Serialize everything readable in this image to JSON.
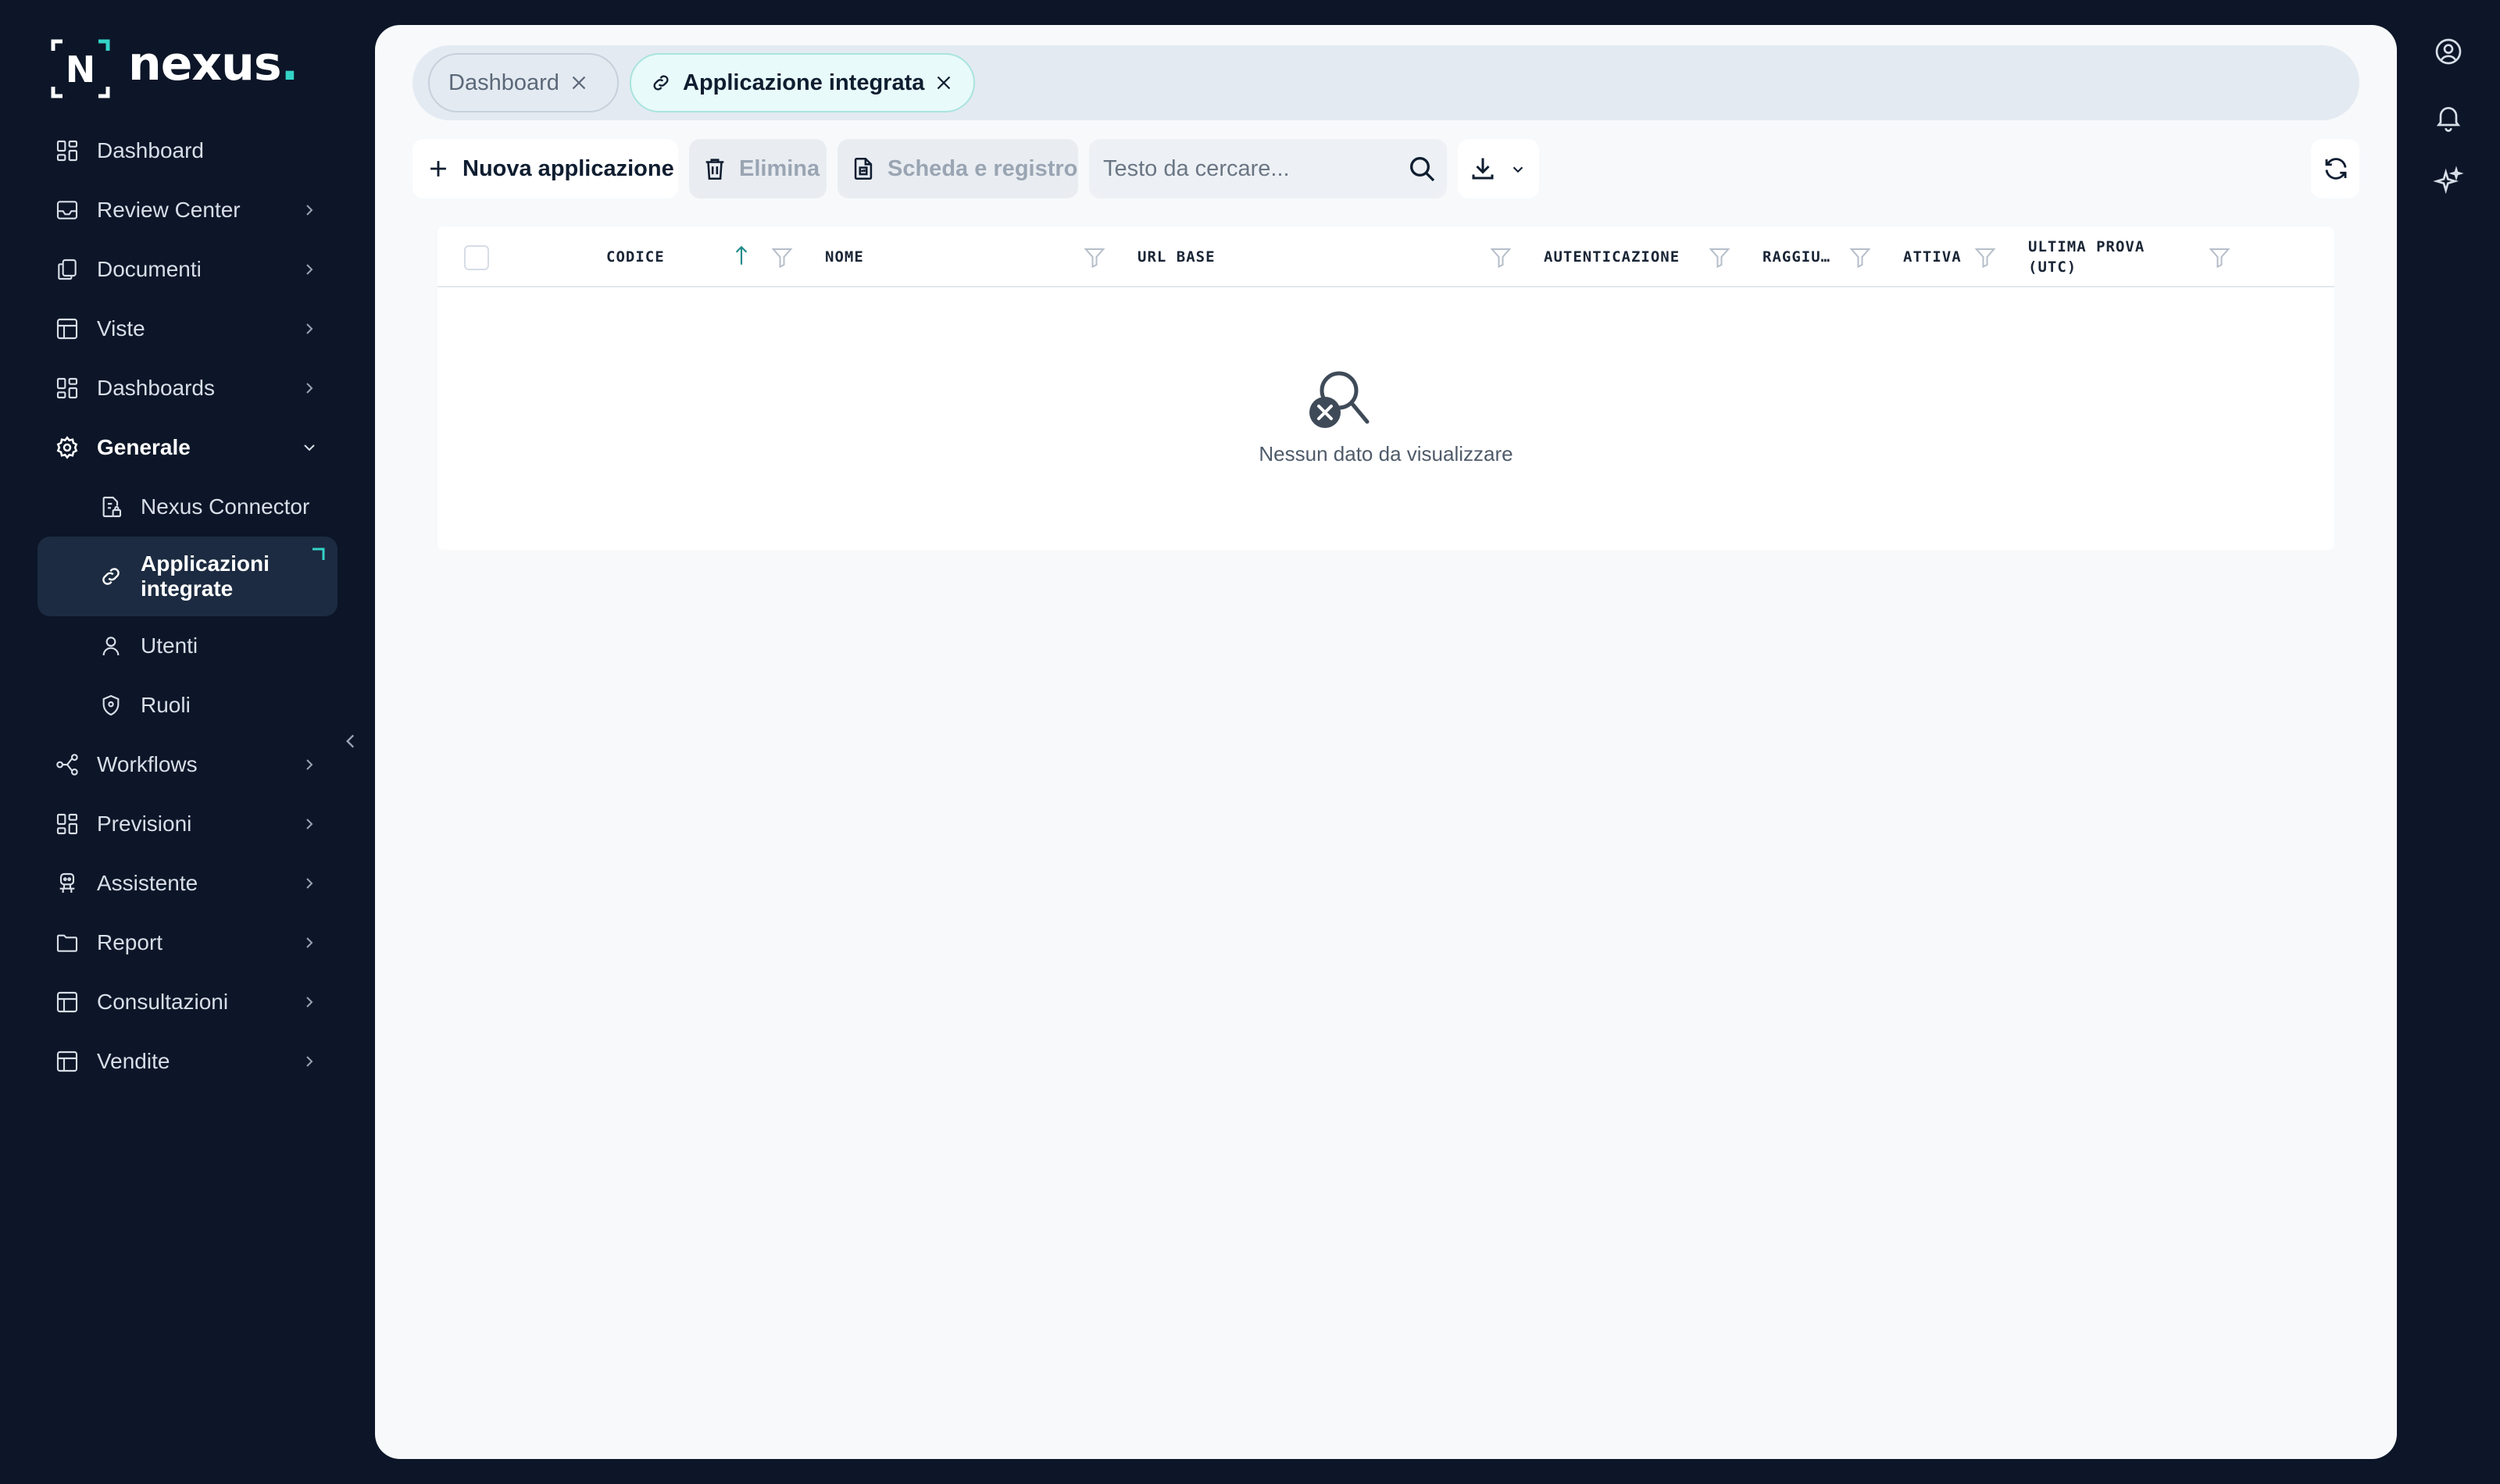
{
  "brand": {
    "name": "nexus",
    "dot": ".",
    "mark_letter": "N",
    "accent": "#33d3c6"
  },
  "sidebar": {
    "items": [
      {
        "label": "Dashboard",
        "icon": "grid-icon"
      },
      {
        "label": "Review Center",
        "icon": "inbox-icon"
      },
      {
        "label": "Documenti",
        "icon": "documents-icon"
      },
      {
        "label": "Viste",
        "icon": "table-icon"
      },
      {
        "label": "Dashboards",
        "icon": "grid-icon"
      },
      {
        "label": "Generale",
        "icon": "gear-icon",
        "expanded": true
      },
      {
        "label": "Nexus Connector",
        "icon": "connector-icon"
      },
      {
        "label": "Applicazioni integrate",
        "icon": "link-icon",
        "active": true
      },
      {
        "label": "Utenti",
        "icon": "user-icon"
      },
      {
        "label": "Ruoli",
        "icon": "shield-icon"
      },
      {
        "label": "Workflows",
        "icon": "workflow-icon"
      },
      {
        "label": "Previsioni",
        "icon": "grid-icon"
      },
      {
        "label": "Assistente",
        "icon": "assistant-icon"
      },
      {
        "label": "Report",
        "icon": "folder-icon"
      },
      {
        "label": "Consultazioni",
        "icon": "table-icon"
      },
      {
        "label": "Vendite",
        "icon": "table-icon"
      }
    ]
  },
  "tabs": [
    {
      "label": "Dashboard",
      "active": false
    },
    {
      "label": "Applicazione integrata",
      "active": true
    }
  ],
  "toolbar": {
    "new_label": "Nuova applicazione",
    "delete_label": "Elimina",
    "sheet_label": "Scheda e registro",
    "search_placeholder": "Testo da cercare..."
  },
  "table": {
    "columns": [
      "CODICE",
      "NOME",
      "URL BASE",
      "AUTENTICAZIONE",
      "RAGGIU…",
      "ATTIVA",
      "ULTIMA PROVA",
      "(UTC)"
    ],
    "sort_column": "CODICE",
    "empty_text": "Nessun dato da visualizzare"
  }
}
